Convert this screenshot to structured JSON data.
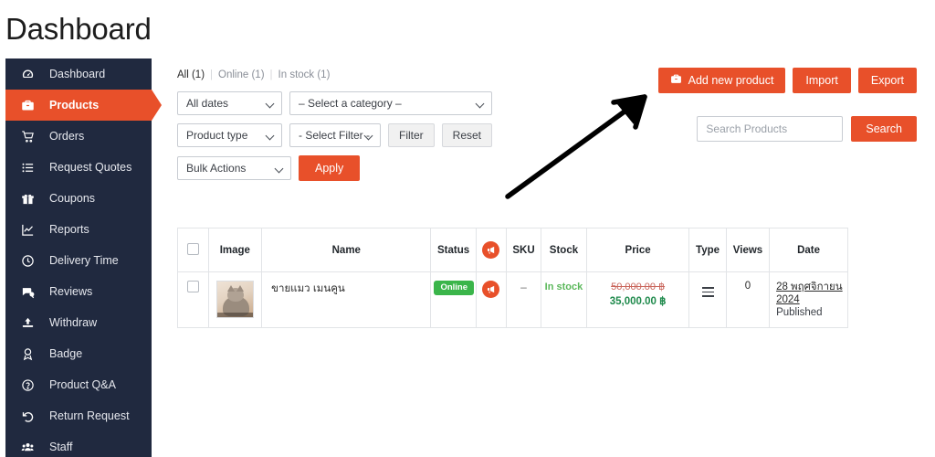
{
  "page": {
    "title": "Dashboard"
  },
  "sidebar": {
    "items": [
      {
        "label": "Dashboard",
        "icon": "gauge-icon",
        "active": false
      },
      {
        "label": "Products",
        "icon": "briefcase-icon",
        "active": true
      },
      {
        "label": "Orders",
        "icon": "shopping-cart-icon",
        "active": false
      },
      {
        "label": "Request Quotes",
        "icon": "list-icon",
        "active": false
      },
      {
        "label": "Coupons",
        "icon": "gift-icon",
        "active": false
      },
      {
        "label": "Reports",
        "icon": "chart-line-icon",
        "active": false
      },
      {
        "label": "Delivery Time",
        "icon": "clock-icon",
        "active": false
      },
      {
        "label": "Reviews",
        "icon": "comments-icon",
        "active": false
      },
      {
        "label": "Withdraw",
        "icon": "upload-icon",
        "active": false
      },
      {
        "label": "Badge",
        "icon": "award-icon",
        "active": false
      },
      {
        "label": "Product Q&A",
        "icon": "question-circle-icon",
        "active": false
      },
      {
        "label": "Return Request",
        "icon": "undo-icon",
        "active": false
      },
      {
        "label": "Staff",
        "icon": "users-icon",
        "active": false
      }
    ]
  },
  "view_tabs": [
    {
      "label": "All (1)",
      "current": true
    },
    {
      "label": "Online (1)",
      "current": false
    },
    {
      "label": "In stock (1)",
      "current": false
    }
  ],
  "top_actions": {
    "add_new_product": "Add new product",
    "add_icon": "briefcase-icon",
    "import": "Import",
    "export": "Export"
  },
  "search": {
    "placeholder": "Search Products",
    "value": "",
    "button": "Search"
  },
  "filters": {
    "date_select": "All dates",
    "category_select": "– Select a category –",
    "product_type_select": "Product type",
    "filter_select": "- Select Filter -",
    "filter_button": "Filter",
    "reset_button": "Reset",
    "bulk_actions_select": "Bulk Actions",
    "apply_button": "Apply"
  },
  "table": {
    "headers": [
      {
        "key": "checkbox",
        "label": ""
      },
      {
        "key": "image",
        "label": "Image"
      },
      {
        "key": "name",
        "label": "Name"
      },
      {
        "key": "status",
        "label": "Status"
      },
      {
        "key": "promo",
        "label": "",
        "icon": "megaphone-icon"
      },
      {
        "key": "sku",
        "label": "SKU"
      },
      {
        "key": "stock",
        "label": "Stock"
      },
      {
        "key": "price",
        "label": "Price"
      },
      {
        "key": "type",
        "label": "Type"
      },
      {
        "key": "views",
        "label": "Views"
      },
      {
        "key": "date",
        "label": "Date"
      }
    ],
    "rows": [
      {
        "image_alt": "cat-thumbnail",
        "name": "ขายแมว เมนคูน",
        "status": "Online",
        "promo_icon": "megaphone-icon",
        "sku": "–",
        "stock": "In stock",
        "price_old": "50,000.00 ฿",
        "price_new": "35,000.00 ฿",
        "type_icon": "hamburger-icon",
        "views": "0",
        "date": "28 พฤศจิกายน 2024",
        "date_status": "Published"
      }
    ]
  },
  "annotation": {
    "type": "arrow",
    "points_to": "add-new-product-button",
    "color": "#000000"
  },
  "colors": {
    "brand_orange": "#e8502a",
    "sidebar_dark": "#20293f",
    "status_green": "#3ab54a",
    "stock_green": "#5bb85b",
    "price_new_green": "#1f8a4c",
    "price_old_red": "#c9645a"
  }
}
